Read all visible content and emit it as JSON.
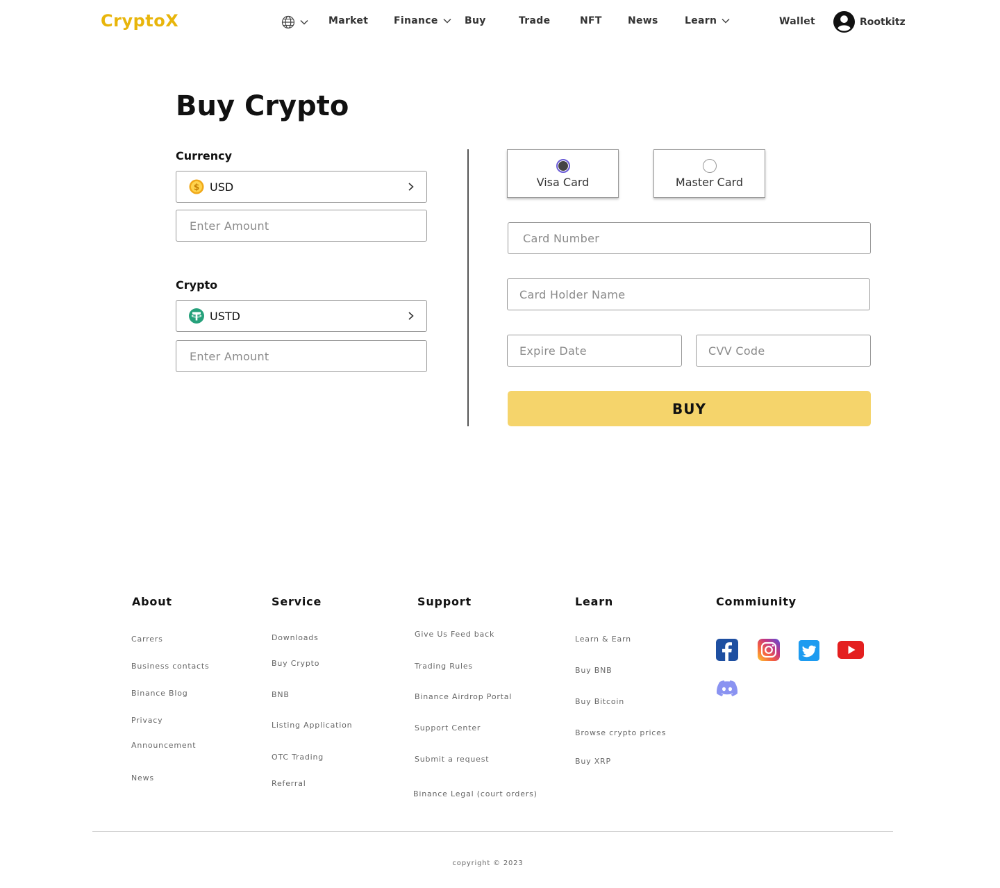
{
  "header": {
    "logo": "CryptoX",
    "nav": {
      "market": "Market",
      "finance": "Finance",
      "buy": "Buy",
      "trade": "Trade",
      "nft": "NFT",
      "news": "News",
      "learn": "Learn",
      "wallet": "Wallet"
    },
    "username": "Rootkitz"
  },
  "main": {
    "title": "Buy Crypto",
    "currency": {
      "label": "Currency",
      "selected": "USD",
      "amount_placeholder": "Enter Amount"
    },
    "crypto": {
      "label": "Crypto",
      "selected": "USTD",
      "amount_placeholder": "Enter Amount"
    },
    "payment": {
      "visa_label": "Visa Card",
      "master_label": "Master Card",
      "selected": "Visa Card",
      "card_number_placeholder": "Card Number",
      "card_holder_placeholder": "Card Holder Name",
      "expire_placeholder": "Expire Date",
      "cvv_placeholder": "CVV Code",
      "buy_label": "BUY"
    }
  },
  "footer": {
    "about": {
      "heading": "About",
      "links": [
        "Carrers",
        "Business contacts",
        "Binance Blog",
        "Privacy",
        "Announcement",
        "News"
      ]
    },
    "service": {
      "heading": "Service",
      "links": [
        "Downloads",
        "Buy Crypto",
        "BNB",
        "Listing Application",
        "OTC Trading",
        "Referral"
      ]
    },
    "support": {
      "heading": "Support",
      "links": [
        "Give Us Feed back",
        "Trading Rules",
        "Binance Airdrop Portal",
        "Support Center",
        "Submit a request",
        "Binance Legal (court orders)"
      ]
    },
    "learn": {
      "heading": "Learn",
      "links": [
        "Learn & Earn",
        "Buy BNB",
        "Buy Bitcoin",
        "Browse crypto prices",
        "Buy XRP"
      ]
    },
    "community": {
      "heading": "Commiunity",
      "icons": [
        "facebook-icon",
        "instagram-icon",
        "twitter-icon",
        "youtube-icon",
        "discord-icon"
      ]
    },
    "copyright": "copyright © 2023"
  },
  "colors": {
    "brand": "#e8b50b",
    "buy_button": "#f5d46b",
    "radio_accent": "#6b5cd6"
  }
}
